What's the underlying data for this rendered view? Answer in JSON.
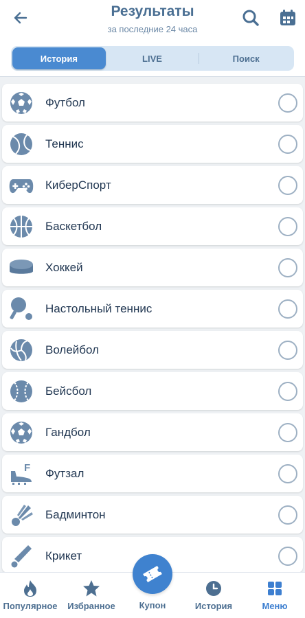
{
  "header": {
    "title": "Результаты",
    "subtitle": "за последние 24 часа",
    "icons": [
      "back-arrow-icon",
      "search-icon",
      "calendar-icon"
    ]
  },
  "tabs": [
    {
      "label": "История",
      "active": true
    },
    {
      "label": "LIVE",
      "active": false
    },
    {
      "label": "Поиск",
      "active": false
    }
  ],
  "sports": [
    {
      "label": "Футбол",
      "icon": "football-icon",
      "selected": false
    },
    {
      "label": "Теннис",
      "icon": "tennis-ball-icon",
      "selected": false
    },
    {
      "label": "КиберСпорт",
      "icon": "gamepad-icon",
      "selected": false
    },
    {
      "label": "Баскетбол",
      "icon": "basketball-icon",
      "selected": false
    },
    {
      "label": "Хоккей",
      "icon": "hockey-puck-icon",
      "selected": false
    },
    {
      "label": "Настольный теннис",
      "icon": "table-tennis-icon",
      "selected": false
    },
    {
      "label": "Волейбол",
      "icon": "volleyball-icon",
      "selected": false
    },
    {
      "label": "Бейсбол",
      "icon": "baseball-icon",
      "selected": false
    },
    {
      "label": "Гандбол",
      "icon": "handball-icon",
      "selected": false
    },
    {
      "label": "Футзал",
      "icon": "futsal-boot-icon",
      "selected": false
    },
    {
      "label": "Бадминтон",
      "icon": "shuttlecock-icon",
      "selected": false
    },
    {
      "label": "Крикет",
      "icon": "cricket-bat-icon",
      "selected": false
    }
  ],
  "bottom_nav": {
    "popular": "Популярное",
    "favorites": "Избранное",
    "coupon": "Купон",
    "history": "История",
    "menu": "Меню"
  },
  "colors": {
    "accent": "#4a8ad1",
    "icon": "#6b8aab",
    "text": "#1f3550",
    "title": "#4a6f93"
  }
}
